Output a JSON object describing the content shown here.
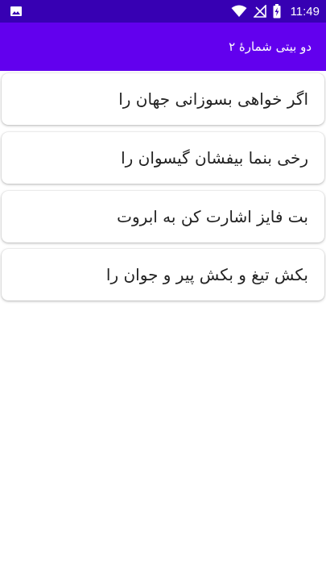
{
  "status_bar": {
    "time": "11:49",
    "icons": [
      "gallery-icon",
      "wifi-icon",
      "no-signal-icon",
      "battery-charging-icon"
    ]
  },
  "app_bar": {
    "title": "دو بیتی شمارۀ ۲"
  },
  "verses": [
    {
      "text": "اگر خواهی بسوزانی جهان را"
    },
    {
      "text": "رخی بنما بیفشان گیسوان را"
    },
    {
      "text": "بت فایز اشارت کن به ابروت"
    },
    {
      "text": "بکش تیغ و بکش پیر و جوان را"
    }
  ],
  "colors": {
    "status_bar": "#3700b3",
    "app_bar": "#6200ee",
    "text": "#222222",
    "background": "#ffffff"
  }
}
